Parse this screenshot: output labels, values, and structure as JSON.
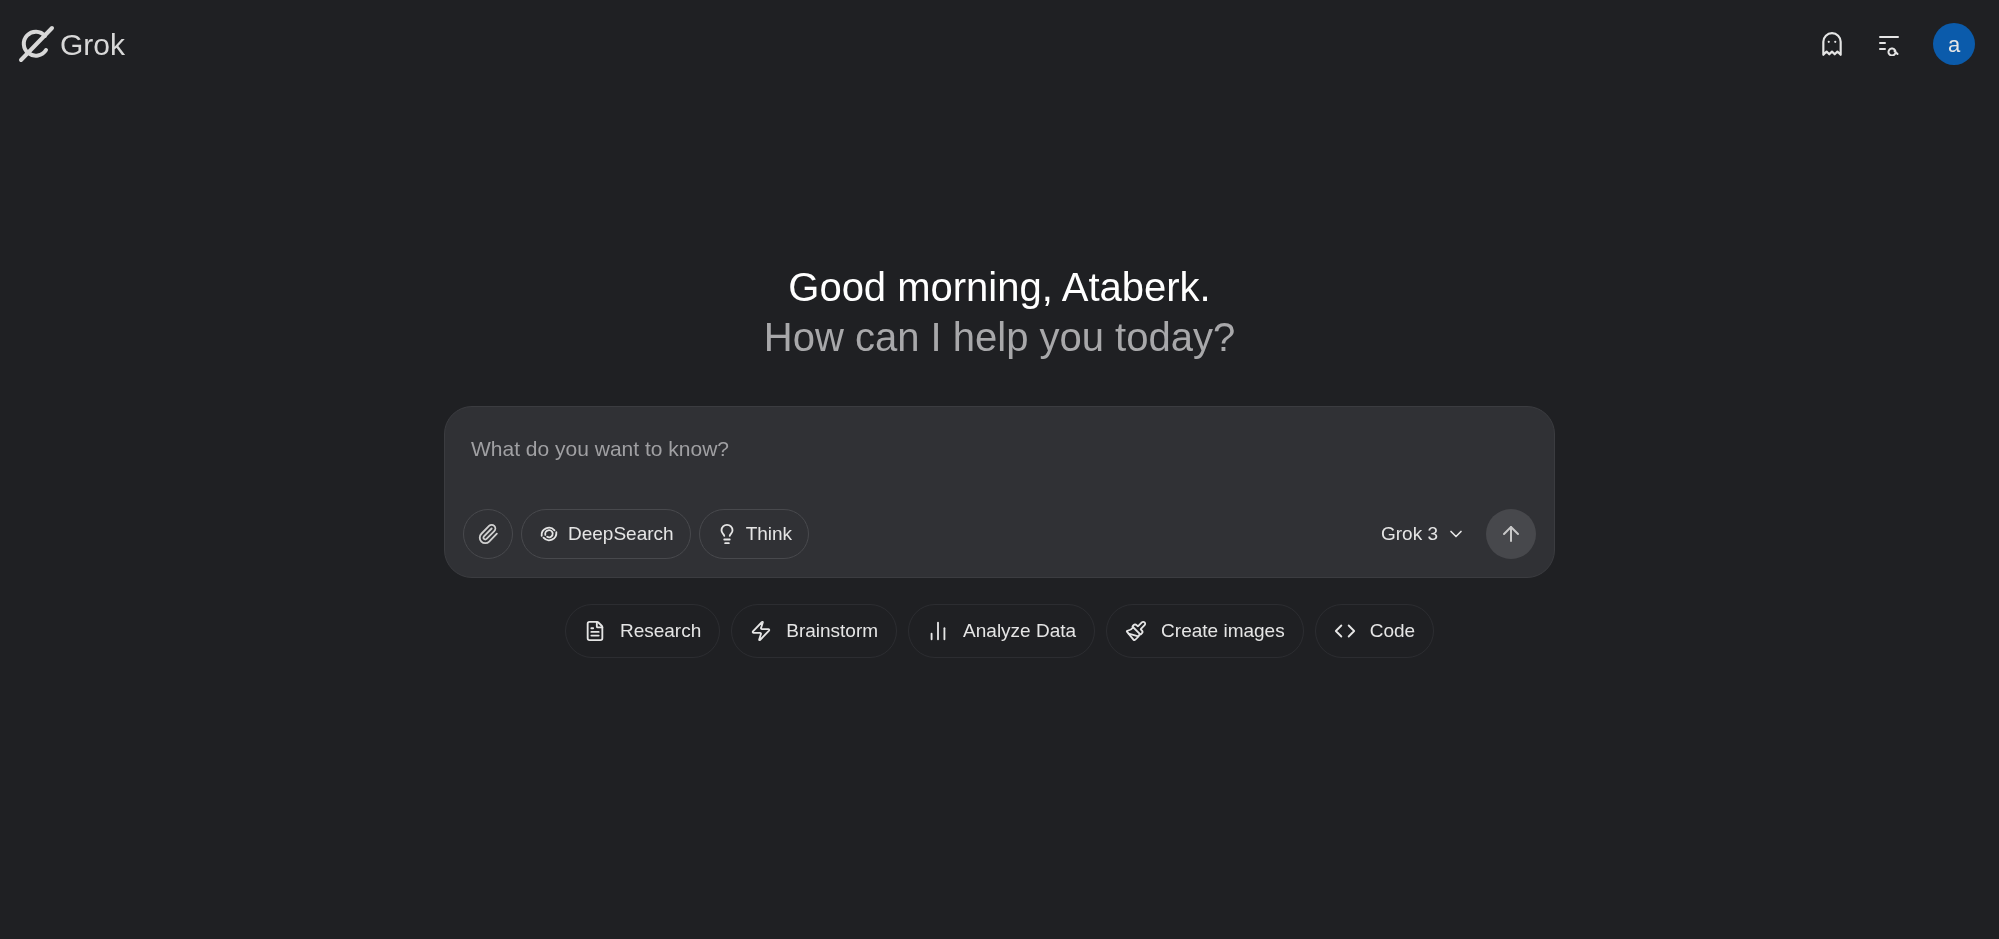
{
  "header": {
    "logo_text": "Grok",
    "avatar_letter": "a"
  },
  "greeting": {
    "title": "Good morning, Ataberk.",
    "subtitle": "How can I help you today?"
  },
  "composer": {
    "placeholder": "What do you want to know?",
    "toggles": [
      {
        "label": "DeepSearch",
        "kind": "deepsearch"
      },
      {
        "label": "Think",
        "kind": "think"
      }
    ],
    "model": "Grok 3"
  },
  "suggestions": [
    {
      "label": "Research",
      "kind": "research"
    },
    {
      "label": "Brainstorm",
      "kind": "brainstorm"
    },
    {
      "label": "Analyze Data",
      "kind": "analyze"
    },
    {
      "label": "Create images",
      "kind": "images"
    },
    {
      "label": "Code",
      "kind": "code"
    }
  ]
}
